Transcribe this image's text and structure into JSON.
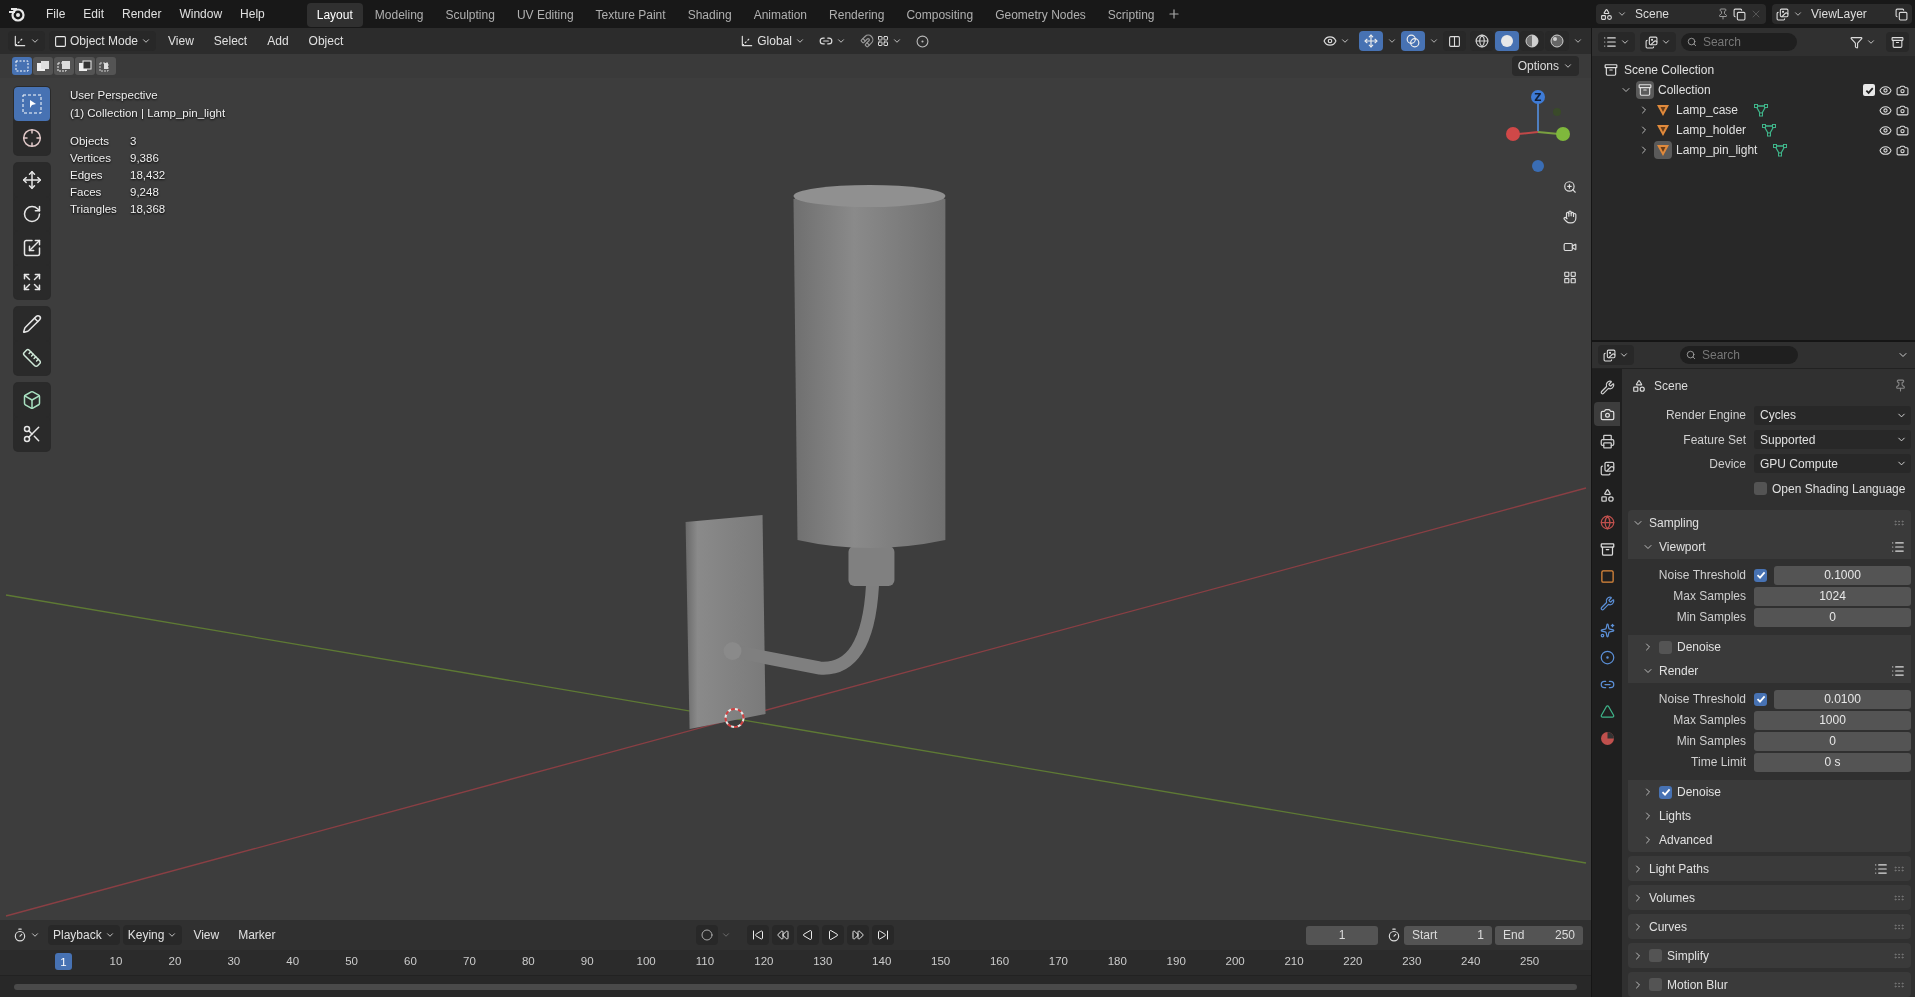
{
  "top_bar": {
    "menus": [
      "File",
      "Edit",
      "Render",
      "Window",
      "Help"
    ],
    "workspaces": [
      {
        "label": "Layout",
        "selected": true
      },
      {
        "label": "Modeling",
        "selected": false
      },
      {
        "label": "Sculpting",
        "selected": false
      },
      {
        "label": "UV Editing",
        "selected": false
      },
      {
        "label": "Texture Paint",
        "selected": false
      },
      {
        "label": "Shading",
        "selected": false
      },
      {
        "label": "Animation",
        "selected": false
      },
      {
        "label": "Rendering",
        "selected": false
      },
      {
        "label": "Compositing",
        "selected": false
      },
      {
        "label": "Geometry Nodes",
        "selected": false
      },
      {
        "label": "Scripting",
        "selected": false
      }
    ],
    "scene": "Scene",
    "view_layer": "ViewLayer"
  },
  "viewport": {
    "mode": "Object Mode",
    "menus": [
      "View",
      "Select",
      "Add",
      "Object"
    ],
    "orientation": "Global",
    "gizmos_on": true,
    "overlays_on": true,
    "shading": [
      {
        "kind": "wireframe",
        "selected": false
      },
      {
        "kind": "solid",
        "selected": true
      },
      {
        "kind": "material",
        "selected": false
      },
      {
        "kind": "rendered",
        "selected": false
      }
    ],
    "select_modes": [
      {
        "kind": "set",
        "selected": true
      },
      {
        "kind": "extend",
        "selected": false
      },
      {
        "kind": "subtract",
        "selected": false
      },
      {
        "kind": "invert",
        "selected": false
      },
      {
        "kind": "intersect",
        "selected": false
      }
    ],
    "options": "Options",
    "toolbar": [
      {
        "tools": [
          {
            "kind": "select",
            "selected": true
          },
          {
            "kind": "cursor",
            "selected": false
          }
        ]
      },
      {
        "tools": [
          {
            "kind": "move",
            "selected": false
          },
          {
            "kind": "rotate",
            "selected": false
          },
          {
            "kind": "scale",
            "selected": false
          },
          {
            "kind": "transform",
            "selected": false
          }
        ]
      },
      {
        "tools": [
          {
            "kind": "annotate",
            "selected": false
          },
          {
            "kind": "measure",
            "selected": false
          }
        ]
      },
      {
        "tools": [
          {
            "kind": "add_cube",
            "selected": false
          },
          {
            "kind": "cut",
            "selected": false
          }
        ]
      }
    ],
    "view_name": "User Perspective",
    "context": "(1) Collection | Lamp_pin_light",
    "stats": [
      {
        "label": "Objects",
        "value": "3"
      },
      {
        "label": "Vertices",
        "value": "9,386"
      },
      {
        "label": "Edges",
        "value": "18,432"
      },
      {
        "label": "Faces",
        "value": "9,248"
      },
      {
        "label": "Triangles",
        "value": "18,368"
      }
    ],
    "gizmo_axis": "Z"
  },
  "outliner": {
    "search": {
      "placeholder": "Search"
    },
    "tree": [
      {
        "name": "Scene Collection",
        "kind": "scene_collection",
        "children": [
          {
            "name": "Collection",
            "kind": "collection",
            "expanded": true,
            "selected": true,
            "checked": true,
            "children": [
              {
                "name": "Lamp_case",
                "kind": "mesh_object",
                "expanded": false,
                "selected": false
              },
              {
                "name": "Lamp_holder",
                "kind": "mesh_object",
                "expanded": false,
                "selected": false
              },
              {
                "name": "Lamp_pin_light",
                "kind": "mesh_object",
                "expanded": false,
                "selected": true
              }
            ]
          }
        ]
      }
    ]
  },
  "properties": {
    "search": {
      "placeholder": "Search"
    },
    "tabs": [
      {
        "kind": "tool",
        "selected": false
      },
      {
        "kind": "render",
        "selected": true
      },
      {
        "kind": "output",
        "selected": false
      },
      {
        "kind": "view_layer",
        "selected": false
      },
      {
        "kind": "scene",
        "selected": false
      },
      {
        "kind": "world",
        "selected": false
      },
      {
        "kind": "collection",
        "selected": false
      },
      {
        "kind": "object",
        "selected": false
      },
      {
        "kind": "modifier",
        "selected": false
      },
      {
        "kind": "particles",
        "selected": false
      },
      {
        "kind": "physics",
        "selected": false
      },
      {
        "kind": "constraints",
        "selected": false
      },
      {
        "kind": "data",
        "selected": false
      },
      {
        "kind": "material",
        "selected": false
      }
    ],
    "context": "Scene",
    "fields": [
      {
        "label": "Render Engine",
        "kind": "dropdown",
        "value": "Cycles"
      },
      {
        "label": "Feature Set",
        "kind": "dropdown",
        "value": "Supported"
      },
      {
        "label": "Device",
        "kind": "dropdown",
        "value": "GPU Compute"
      },
      {
        "label": "Open Shading Language",
        "kind": "checkbox",
        "checked": false
      }
    ],
    "panels": [
      {
        "title": "Sampling",
        "expanded": true,
        "children": [
          {
            "title": "Viewport",
            "expanded": true,
            "presets": true,
            "rows": [
              {
                "label": "Noise Threshold",
                "kind": "toggle_number",
                "checked": true,
                "value": "0.1000"
              },
              {
                "label": "Max Samples",
                "kind": "number",
                "value": "1024"
              },
              {
                "label": "Min Samples",
                "kind": "number",
                "value": "0"
              }
            ]
          },
          {
            "title": "Denoise",
            "expanded": false,
            "checked": false
          },
          {
            "title": "Render",
            "expanded": true,
            "presets": true,
            "rows": [
              {
                "label": "Noise Threshold",
                "kind": "toggle_number",
                "checked": true,
                "value": "0.0100"
              },
              {
                "label": "Max Samples",
                "kind": "number",
                "value": "1000"
              },
              {
                "label": "Min Samples",
                "kind": "number",
                "value": "0"
              },
              {
                "label": "Time Limit",
                "kind": "number",
                "value": "0 s"
              }
            ]
          },
          {
            "title": "Denoise",
            "expanded": false,
            "checked": true
          },
          {
            "title": "Lights",
            "expanded": false
          },
          {
            "title": "Advanced",
            "expanded": false
          }
        ]
      },
      {
        "title": "Light Paths",
        "expanded": false,
        "presets": true
      },
      {
        "title": "Volumes",
        "expanded": false
      },
      {
        "title": "Curves",
        "expanded": false
      },
      {
        "title": "Simplify",
        "expanded": false,
        "checked": false
      },
      {
        "title": "Motion Blur",
        "expanded": false,
        "checked": false
      }
    ]
  },
  "timeline": {
    "menus": [
      {
        "label": "Playback",
        "dropdown": true
      },
      {
        "label": "Keying",
        "dropdown": true
      },
      {
        "label": "View",
        "dropdown": false
      },
      {
        "label": "Marker",
        "dropdown": false
      }
    ],
    "auto_keying": false,
    "current_frame": "1",
    "start_label": "Start",
    "start": "1",
    "end_label": "End",
    "end": "250",
    "ruler": {
      "current": "1",
      "ticks": [
        "10",
        "20",
        "30",
        "40",
        "50",
        "60",
        "70",
        "80",
        "90",
        "100",
        "110",
        "120",
        "130",
        "140",
        "150",
        "160",
        "170",
        "180",
        "190",
        "200",
        "210",
        "220",
        "230",
        "240",
        "250"
      ]
    }
  }
}
